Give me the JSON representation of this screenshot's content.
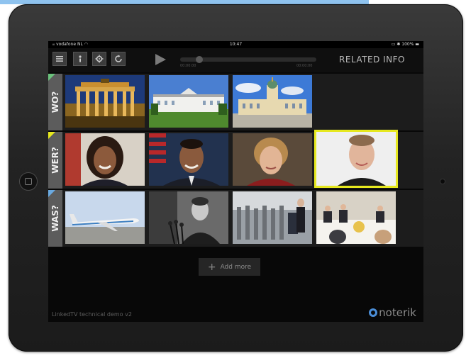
{
  "status": {
    "carrier": "vodafone NL",
    "time": "10:47",
    "battery": "100%"
  },
  "toolbar": {
    "icons": [
      "menu-icon",
      "info-icon",
      "gear-icon",
      "refresh-icon",
      "play-icon"
    ],
    "time_start": "00:00:00",
    "time_end": "00:00:00",
    "playback_progress": 0.12,
    "title": "RELATED INFO"
  },
  "rows": [
    {
      "label": "WO?",
      "color": "#6bc27c",
      "items": [
        "Brandenburg Gate",
        "Bellevue Palace",
        "Charlottenburg Palace"
      ]
    },
    {
      "label": "WER?",
      "color": "#e6e81f",
      "items": [
        "Michelle Obama",
        "Barack Obama",
        "Angela Merkel",
        "Man in black shirt"
      ]
    },
    {
      "label": "WAS?",
      "color": "#6aa9e0",
      "items": [
        "Air Force One",
        "Kennedy speech",
        "Press conference",
        "State dinner"
      ]
    }
  ],
  "add_more": {
    "label": "Add more"
  },
  "footer": {
    "text": "LinkedTV technical demo v2"
  },
  "logo": {
    "text": "noterik"
  },
  "colors": {
    "selected_outline": "#e6e81f",
    "logo_blue": "#4b8ed8"
  }
}
